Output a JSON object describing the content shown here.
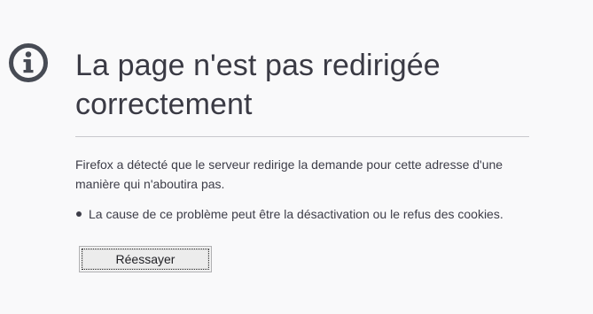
{
  "error_page": {
    "icon": "info-icon",
    "title": "La page n'est pas redirigée correctement",
    "description": "Firefox a détecté que le serveur redirige la demande pour cette adresse d'une manière qui n'aboutira pas.",
    "reasons": [
      "La cause de ce problème peut être la désactivation ou le refus des cookies."
    ],
    "retry_label": "Réessayer"
  },
  "colors": {
    "background": "#f9f9fa",
    "text": "#4d4d57",
    "icon": "#474b54",
    "divider": "#c8c8cc",
    "button_background": "#f0f0f0",
    "button_border": "#b1b1b3"
  }
}
